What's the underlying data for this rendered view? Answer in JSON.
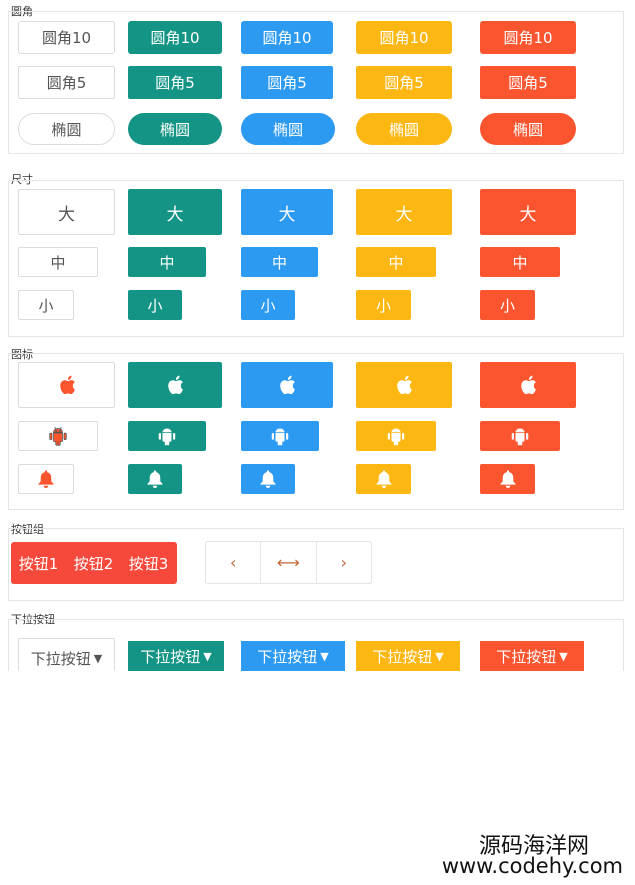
{
  "sections": {
    "rounded": "圆角",
    "size": "尺寸",
    "icon": "图标",
    "group": "按钮组",
    "dropdown": "下拉按钮"
  },
  "rounded": {
    "r10": "圆角10",
    "r5": "圆角5",
    "ellipse": "椭圆"
  },
  "size": {
    "large": "大",
    "medium": "中",
    "small": "小"
  },
  "icons": [
    "apple-icon",
    "android-icon",
    "bell-icon"
  ],
  "button_group": {
    "items": [
      "按钮1",
      "按钮2",
      "按钮3"
    ],
    "nav": [
      "‹",
      "⟷",
      "›"
    ]
  },
  "dropdown": {
    "label": "下拉按钮",
    "arrow": "▼"
  },
  "colors": {
    "white": "#ffffff",
    "teal": "#139485",
    "blue": "#2d9af2",
    "yellow": "#fdb712",
    "red": "#fb5530"
  },
  "watermark": {
    "line1": "源码海洋网",
    "line2": "www.codehy.com"
  }
}
